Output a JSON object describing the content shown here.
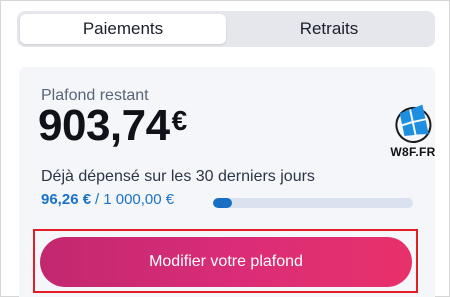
{
  "tabs": [
    {
      "label": "Paiements",
      "active": true
    },
    {
      "label": "Retraits",
      "active": false
    }
  ],
  "card": {
    "remaining_label": "Plafond restant",
    "remaining_amount": "903,74",
    "remaining_currency": "€",
    "spent_label": "Déjà dépensé sur les 30 derniers jours",
    "spent_value": "96,26 €",
    "spent_separator": "/",
    "spent_limit": "1 000,00 €",
    "progress_fraction": 0.0963
  },
  "cta": {
    "label": "Modifier votre plafond"
  },
  "watermark": {
    "text": "W8F.FR",
    "icon": "windows-logo-icon"
  },
  "colors": {
    "accent_blue": "#1a73c8",
    "cta_pink": "#d92c78",
    "highlight_red": "#e31e24"
  }
}
